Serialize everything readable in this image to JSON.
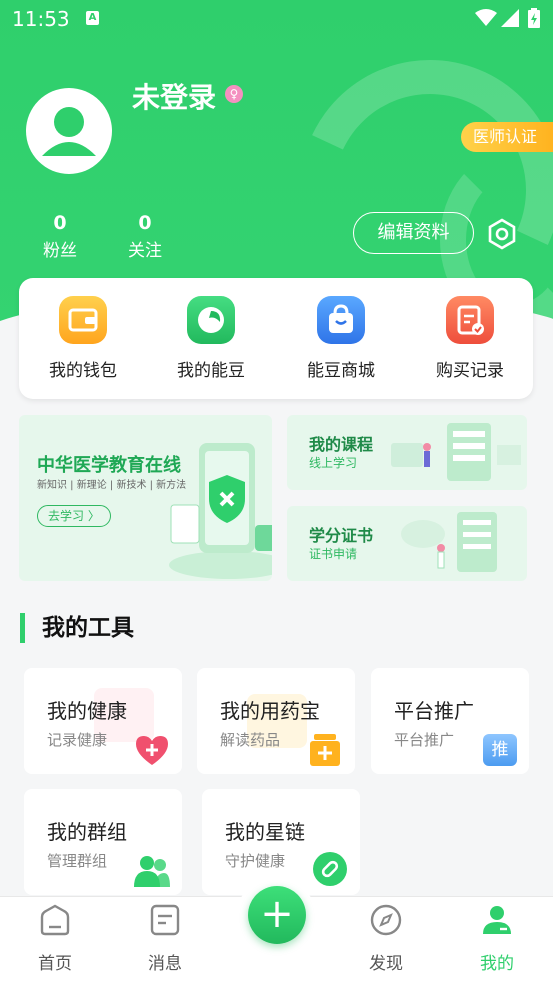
{
  "status_bar": {
    "time": "11:53",
    "notification_icon": "A"
  },
  "profile": {
    "username": "未登录",
    "gender_icon": "female-icon",
    "doctor_badge": "医师认证",
    "fans_count": "0",
    "fans_label": "粉丝",
    "follow_count": "0",
    "follow_label": "关注",
    "edit_button": "编辑资料"
  },
  "quick_actions": [
    {
      "label": "我的钱包",
      "icon": "wallet-icon",
      "color": "#ffb21e"
    },
    {
      "label": "我的能豆",
      "icon": "bean-icon",
      "color": "#2fcf6c"
    },
    {
      "label": "能豆商城",
      "icon": "shopping-bag-icon",
      "color": "#3d8cf5"
    },
    {
      "label": "购买记录",
      "icon": "clipboard-check-icon",
      "color": "#f5664a"
    }
  ],
  "banners": {
    "main": {
      "title": "中华医学教育在线",
      "subtitle": "新知识 | 新理论 | 新技术 | 新方法",
      "button": "去学习 〉"
    },
    "course": {
      "title": "我的课程",
      "subtitle": "线上学习"
    },
    "credit": {
      "title": "学分证书",
      "subtitle": "证书申请"
    }
  },
  "tools": {
    "section_title": "我的工具",
    "items": [
      {
        "title": "我的健康",
        "subtitle": "记录健康",
        "icon": "heart-plus-icon",
        "color": "#f0506e"
      },
      {
        "title": "我的用药宝",
        "subtitle": "解读药品",
        "icon": "medicine-box-icon",
        "color": "#ffb21e"
      },
      {
        "title": "平台推广",
        "subtitle": "平台推广",
        "icon": "promote-icon",
        "icon_text": "推",
        "color": "#5aa8f5"
      },
      {
        "title": "我的群组",
        "subtitle": "管理群组",
        "icon": "group-icon",
        "color": "#2fcf6c"
      },
      {
        "title": "我的星链",
        "subtitle": "守护健康",
        "icon": "link-icon",
        "color": "#2fcf6c"
      }
    ]
  },
  "tabbar": {
    "home": "首页",
    "messages": "消息",
    "add": "+",
    "discover": "发现",
    "mine": "我的"
  },
  "colors": {
    "brand_green": "#2fcf6c",
    "badge_yellow": "#ffb21e"
  }
}
